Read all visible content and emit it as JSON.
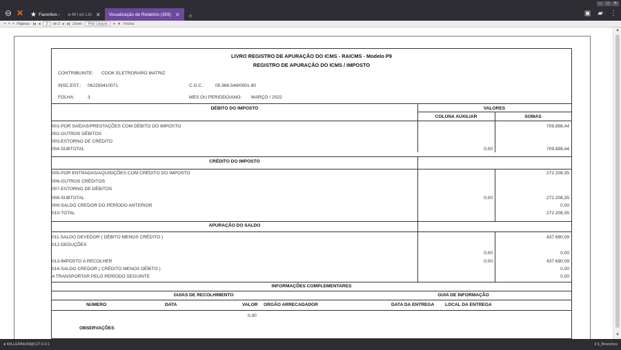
{
  "browser": {
    "tabs": [
      {
        "label": "Favoritos -",
        "active": false
      },
      {
        "label": "e-M l en Lín",
        "active": false
      },
      {
        "label": "Visualização de Relatório (359)",
        "active": true
      }
    ],
    "status_left": "MILLENNIUM@127.0.0.1",
    "status_right": "5_Branches"
  },
  "toolbar": {
    "pages_label": "Páginas:",
    "page_current": "3",
    "page_of": "de 3",
    "zoom_label": "Zoom:",
    "zoom_value": "Pela Largura",
    "close_label": "Fechar"
  },
  "report": {
    "title1": "LIVRO REGISTRO DE APURAÇÃO DO ICMS - RAICMS - Modelo P9",
    "title2": "REGISTRO DE APURAÇÃO DO ICMS / IMPOSTO",
    "contribuinte_label": "CONTRIBUINTE:",
    "contribuinte_value": "COOK ELETRORARO MATRIZ",
    "insc_label": "INSC.EST.:",
    "insc_value": "062293410071",
    "cgc_label": "C.G.C.:",
    "cgc_value": "05.966.548/0001-90",
    "folha_label": "FOLHA:",
    "folha_value": "3",
    "mes_label": "MES OU PERIODO/ANO:",
    "mes_value": "MARÇO / 2022",
    "debito_header": "DÉBITO DO IMPOSTO",
    "valores_header": "VALORES",
    "col_aux": "COLUNA AUXILIAR",
    "col_somas": "SOMAS",
    "debito_rows": [
      {
        "label": "001-POR SAÍDAS/PRESTAÇÕES COM DÉBITO DO IMPOSTO",
        "aux": "",
        "soma": "709.898,44"
      },
      {
        "label": "002-OUTROS DÉBITOS",
        "aux": "",
        "soma": ""
      },
      {
        "label": "003-ESTORNO DE CRÉDITO",
        "aux": "",
        "soma": ""
      },
      {
        "label": "004-SUBTOTAL",
        "aux": "0,00",
        "soma": "709.898,44"
      }
    ],
    "credito_header": "CRÉDITO DO IMPOSTO",
    "credito_rows": [
      {
        "label": "005-POR ENTRADAS/AQUISIÇÕES COM CRÉDITO DO IMPOSTO",
        "aux": "",
        "soma": "272.208,35"
      },
      {
        "label": "006-OUTROS CRÉDITOS",
        "aux": "",
        "soma": ""
      },
      {
        "label": "007-ESTORNO DE DÉBITOS",
        "aux": "",
        "soma": ""
      },
      {
        "label": "008-SUBTOTAL",
        "aux": "0,00",
        "soma": "272.208,35"
      },
      {
        "label": "009-SALDO CREDOR DO PERÍODO ANTERIOR",
        "aux": "",
        "soma": "0,00"
      },
      {
        "label": "010-TOTAL",
        "aux": "",
        "soma": "272.208,35"
      }
    ],
    "apuracao_header": "APURAÇÃO DO SALDO",
    "apuracao_rows": [
      {
        "label": "011-SALDO DEVEDOR ( DÉBITO MENOS CRÉDITO )",
        "aux": "",
        "soma": "437.690,09"
      },
      {
        "label": "012-DEDUÇÕES",
        "aux": "",
        "soma": ""
      },
      {
        "label": "",
        "aux": "0,00",
        "soma": "0,00"
      },
      {
        "label": "013-IMPOSTO A RECOLHER",
        "aux": "0,00",
        "soma": "437.690,09"
      },
      {
        "label": "014-SALDO CREDOR ( CRÉDITO MENOS DÉBITO )",
        "aux": "",
        "soma": "0,00"
      },
      {
        "label": "A TRANSPORTAR PELO PERÍODO SEGUINTE",
        "aux": "",
        "soma": "0,00"
      }
    ],
    "info_header": "INFORMAÇÕES COMPLEMENTARES",
    "guias_header": "GUIAS DE RECOLHIMENTO",
    "guia_info_header": "GUIA DE INFORMAÇÃO",
    "col_numero": "NÚMERO",
    "col_data": "DATA",
    "col_valor": "VALOR",
    "col_orgao": "ORGÃO ARRECADADOR",
    "col_data_entrega": "DATA DA ENTREGA",
    "col_local_entrega": "LOCAL DA ENTREGA",
    "valor_value": "0,00",
    "observacoes": "OBSERVAÇÕES"
  }
}
